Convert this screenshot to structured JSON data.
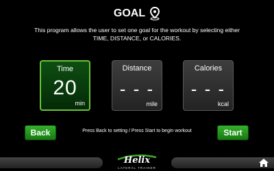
{
  "header": {
    "title": "GOAL",
    "description": "This program allows the user to set one goal for the workout by selecting either TIME, DISTANCE, or CALORIES."
  },
  "goals": [
    {
      "label": "Time",
      "value": "20",
      "unit": "min",
      "selected": true
    },
    {
      "label": "Distance",
      "value": "- - -",
      "unit": "mile",
      "selected": false
    },
    {
      "label": "Calories",
      "value": "- - -",
      "unit": "kcal",
      "selected": false
    }
  ],
  "actions": {
    "back_label": "Back",
    "start_label": "Start",
    "prompt": "Press Back to setting / Press Start to begin workout"
  },
  "footer": {
    "logo_name": "Helix",
    "logo_sub": "LATERAL TRAINER"
  },
  "colors": {
    "accent": "#69c23a",
    "button": "#22992a"
  }
}
